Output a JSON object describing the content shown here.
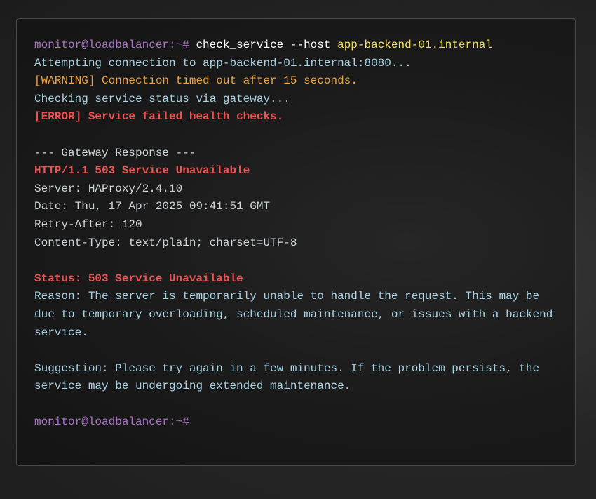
{
  "terminal": {
    "prompt": "monitor@loadbalancer:~#",
    "command": "check_service --host",
    "host_argument": "app-backend-01.internal",
    "lines": {
      "attempting": "Attempting connection to app-backend-01.internal:8080...",
      "warning": "[WARNING] Connection timed out after 15 seconds.",
      "checking": "Checking service status via gateway...",
      "error": "[ERROR] Service failed health checks.",
      "gateway_header": "--- Gateway Response ---",
      "http_status": "HTTP/1.1 503 Service Unavailable",
      "server": "Server: HAProxy/2.4.10",
      "date": "Date: Thu, 17 Apr 2025 09:41:51 GMT",
      "retry_after": "Retry-After: 120",
      "content_type": "Content-Type: text/plain; charset=UTF-8",
      "status": "Status: 503 Service Unavailable",
      "reason": "Reason: The server is temporarily unable to handle the request. This may be due to temporary overloading, scheduled maintenance, or issues with a backend service.",
      "suggestion": "Suggestion: Please try again in a few minutes. If the problem persists, the service may be undergoing extended maintenance."
    },
    "final_prompt": "monitor@loadbalancer:~#"
  },
  "colors": {
    "prompt": "#a974c4",
    "command": "#ffffff",
    "host_argument": "#f2e14c",
    "info": "#a9d3e3",
    "warning": "#f0a23b",
    "error": "#ee5353",
    "header_text": "#cfd6da",
    "terminal_background": "#1a1a1a"
  }
}
